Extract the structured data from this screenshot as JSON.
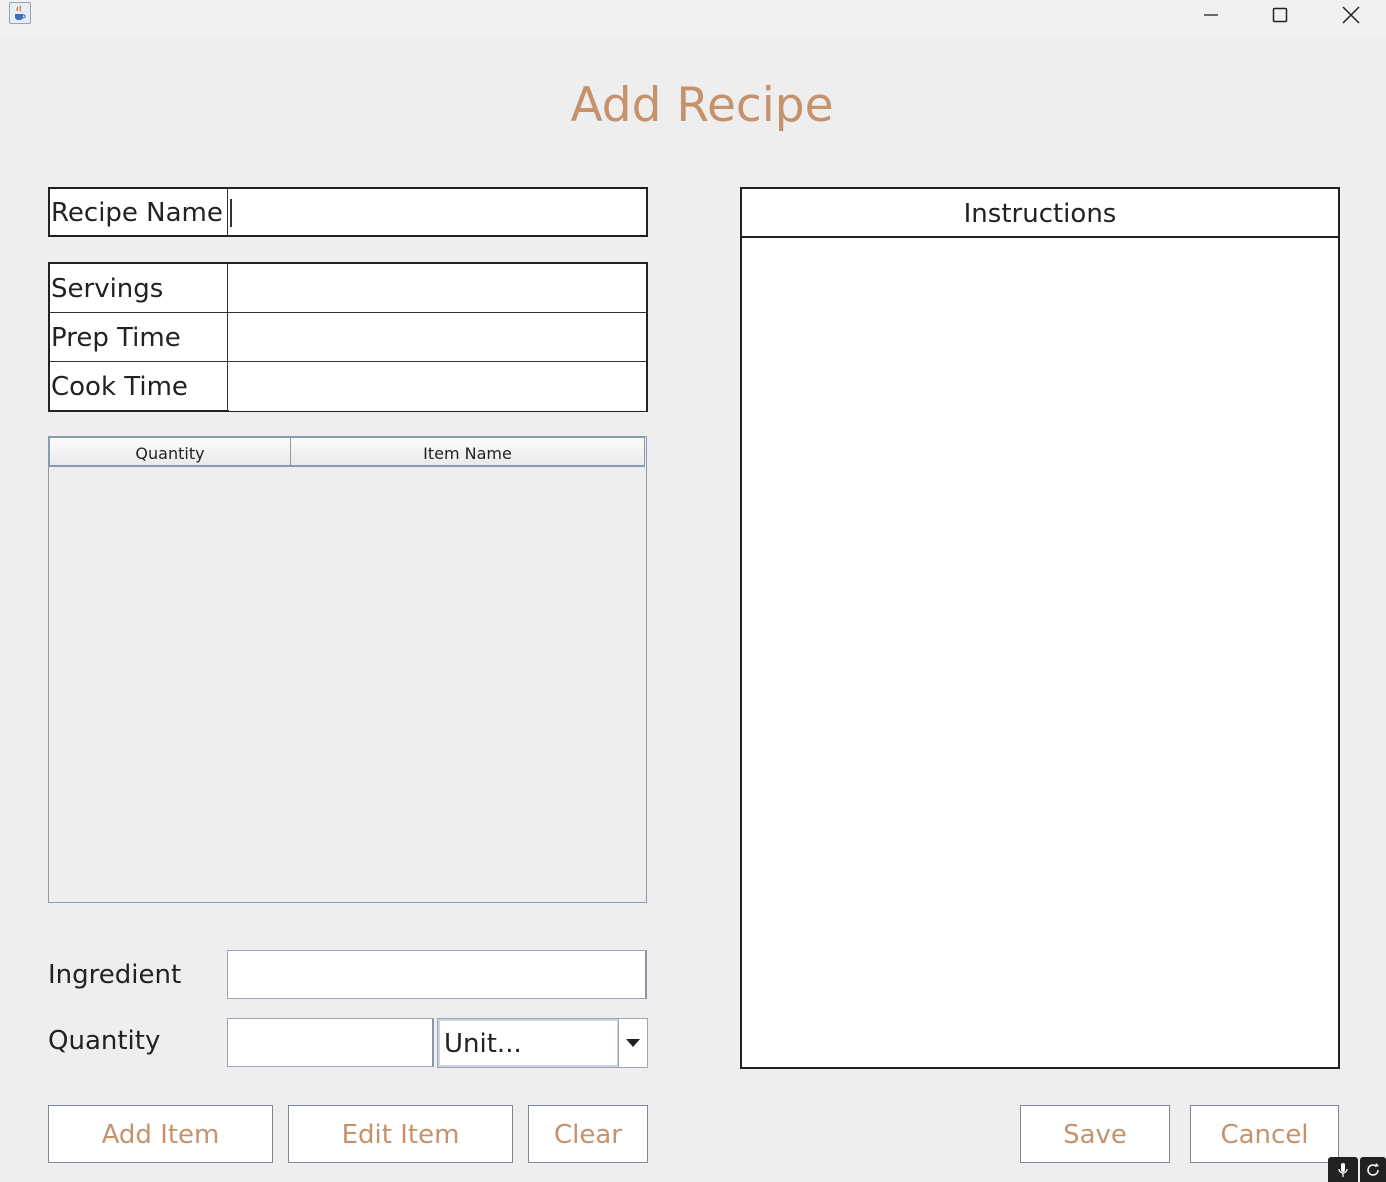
{
  "window": {
    "icon": "java-cup-icon",
    "controls": [
      "minimize-icon",
      "maximize-icon",
      "close-icon"
    ]
  },
  "title": "Add Recipe",
  "recipe_name": {
    "label": "Recipe Name",
    "value": ""
  },
  "details": [
    {
      "label": "Servings",
      "value": ""
    },
    {
      "label": "Prep Time",
      "value": ""
    },
    {
      "label": "Cook Time",
      "value": ""
    }
  ],
  "ingredients_table": {
    "columns": [
      "Quantity",
      "Item Name"
    ],
    "rows": []
  },
  "ingredient_form": {
    "ingredient_label": "Ingredient",
    "ingredient_value": "",
    "quantity_label": "Quantity",
    "quantity_value": "",
    "unit_selected": "Unit..."
  },
  "instructions": {
    "header": "Instructions",
    "text": ""
  },
  "buttons": {
    "add_item": "Add Item",
    "edit_item": "Edit Item",
    "clear": "Clear",
    "save": "Save",
    "cancel": "Cancel"
  },
  "colors": {
    "accent": "#c5926c",
    "background": "#eeeeee",
    "border": "#222222"
  }
}
